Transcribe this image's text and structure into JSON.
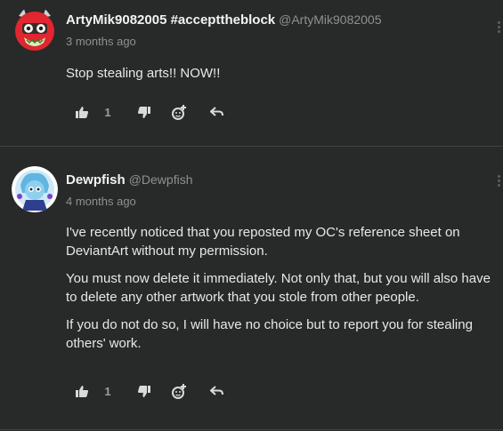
{
  "comments": [
    {
      "display_name": "ArtyMik9082005 #accepttheblock",
      "handle": "@ArtyMik9082005",
      "time": "3 months ago",
      "paragraphs": [
        "Stop stealing arts!! NOW!!"
      ],
      "likes": "1"
    },
    {
      "display_name": "Dewpfish",
      "handle": "@Dewpfish",
      "time": "4 months ago",
      "paragraphs": [
        "I've recently noticed that you reposted my OC's reference sheet on DeviantArt without my permission.",
        "You must now delete it immediately. Not only that, but you will also have to delete any other artwork that you stole from other people.",
        "If you do not do so, I will have no choice but to report you for stealing others' work."
      ],
      "likes": "1"
    }
  ],
  "icons": {
    "like": "thumbs-up-icon",
    "dislike": "thumbs-down-icon",
    "react": "add-reaction-icon",
    "reply": "reply-icon",
    "more": "more-vertical-icon"
  },
  "colors": {
    "background": "#272a29",
    "text": "#e6e7e6",
    "muted": "#8d918f",
    "divider": "#3f4341",
    "avatar1": "#e0262f",
    "avatar2": "#7fc6e8"
  }
}
